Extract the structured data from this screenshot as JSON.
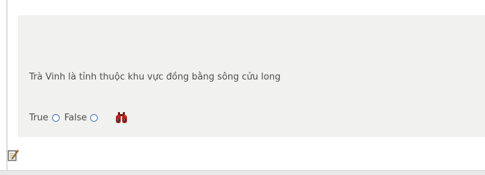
{
  "question": {
    "text": "Trà Vinh là tỉnh thuộc khu vực đồng bằng sông cửu long"
  },
  "answers": {
    "true_label": "True",
    "false_label": "False"
  },
  "icons": {
    "hint": "binoculars-icon",
    "edit": "edit-icon"
  },
  "colors": {
    "panel_bg": "#f1f1ef",
    "radio_border": "#3d6fc4",
    "text": "#4e4e4e"
  }
}
